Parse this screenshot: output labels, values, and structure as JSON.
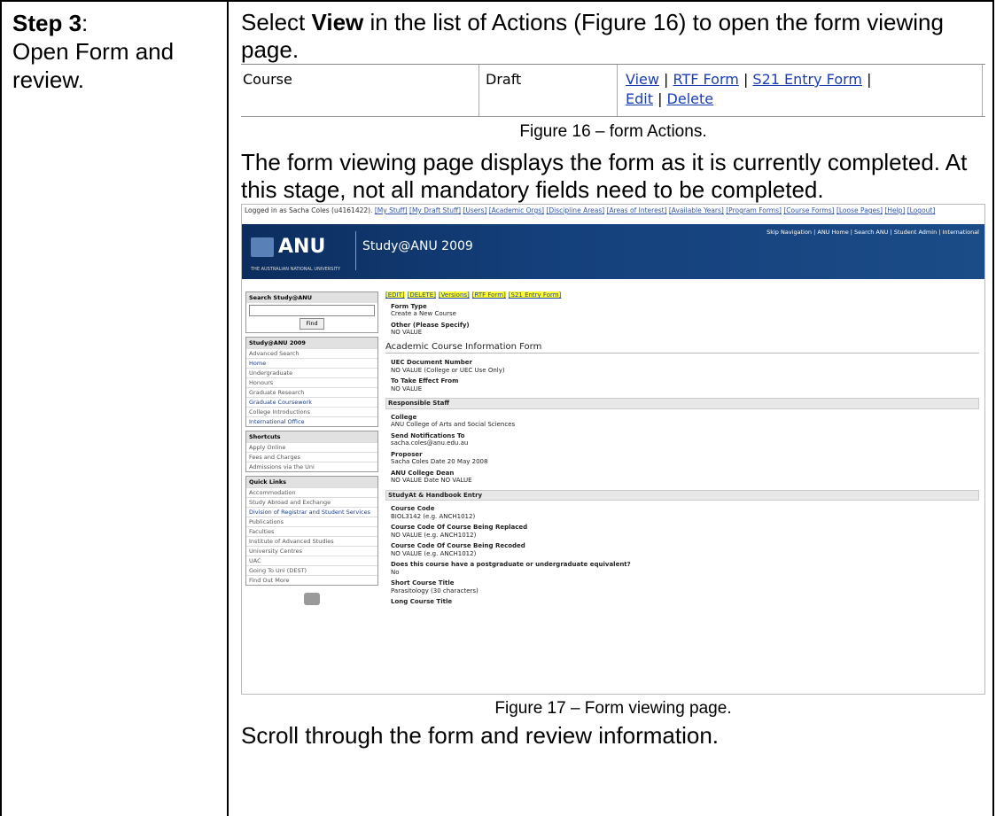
{
  "step": {
    "label": "Step 3",
    "colon": ":",
    "description": "Open Form and review."
  },
  "intro": {
    "before": "Select ",
    "bold": "View",
    "after": " in the list of Actions (Figure 16) to open the form viewing page."
  },
  "figure16": {
    "col1": "Course",
    "col2": "Draft",
    "links": [
      "View",
      "RTF Form",
      "S21 Entry Form",
      "Edit",
      "Delete"
    ],
    "sep": " | ",
    "caption": "Figure 16 – form Actions."
  },
  "para2": "The form viewing page displays the form as it is currently completed.  At this stage, not all mandatory fields need to be completed.",
  "figure17": {
    "caption": "Figure 17 – Form viewing page.",
    "logged_in": "Logged in as Sacha Coles (u4161422).",
    "top_links": [
      "[My Stuff]",
      "[My Draft Stuff]",
      "[Users]",
      "[Academic Orgs]",
      "[Discipline Areas]",
      "[Areas of Interest]",
      "[Available Years]",
      "[Program Forms]",
      "[Course Forms]",
      "[Loose Pages]",
      "[Help]",
      "[Logout]"
    ],
    "banner_nav": "Skip Navigation | ANU Home | Search ANU | Student Admin | International",
    "logo": "ANU",
    "university": "THE AUSTRALIAN NATIONAL UNIVERSITY",
    "site_title": "Study@ANU 2009",
    "search_header": "Search Study@ANU",
    "find_label": "Find",
    "study_header": "Study@ANU 2009",
    "study_items": [
      "Advanced Search",
      "Home",
      "Undergraduate",
      "Honours",
      "Graduate Research",
      "Graduate Coursework",
      "College Introductions",
      "International Office"
    ],
    "shortcuts_header": "Shortcuts",
    "shortcuts": [
      "Apply Online",
      "Fees and Charges",
      "Admissions via the Uni"
    ],
    "quick_header": "Quick Links",
    "quick_links": [
      "Accommodation",
      "Study Abroad and Exchange",
      "Division of Registrar and Student Services",
      "Publications",
      "Faculties",
      "Institute of Advanced Studies",
      "University Centres",
      "UAC",
      "Going To Uni (DEST)",
      "Find Out More"
    ],
    "actions": [
      "[EDIT]",
      "[DELETE]",
      "[Versions]",
      "[RTF Form]",
      "[S21 Entry Form]"
    ],
    "fields_a": [
      {
        "name": "Form Type",
        "value": "Create a New Course"
      },
      {
        "name": "Other (Please Specify)",
        "value": "NO VALUE"
      }
    ],
    "form_heading": "Academic Course Information Form",
    "fields_b": [
      {
        "name": "UEC Document Number",
        "value": "NO VALUE (College or UEC Use Only)"
      },
      {
        "name": "To Take Effect From",
        "value": "NO VALUE"
      }
    ],
    "section_staff": "Responsible Staff",
    "fields_c": [
      {
        "name": "College",
        "value": "ANU College of Arts and Social Sciences"
      },
      {
        "name": "Send Notifications To",
        "value": "sacha.coles@anu.edu.au"
      },
      {
        "name": "Proposer",
        "value": "Sacha Coles Date 20 May 2008"
      },
      {
        "name": "ANU College Dean",
        "value": "NO VALUE Date NO VALUE"
      }
    ],
    "section_handbook": "StudyAt & Handbook Entry",
    "fields_d": [
      {
        "name": "Course Code",
        "value": "BIOL3142 (e.g. ANCH1012)"
      },
      {
        "name": "Course Code Of Course Being Replaced",
        "value": "NO VALUE (e.g. ANCH1012)"
      },
      {
        "name": "Course Code Of Course Being Recoded",
        "value": "NO VALUE (e.g. ANCH1012)"
      },
      {
        "name": "Does this course have a postgraduate or undergraduate equivalent?",
        "value": "No"
      },
      {
        "name": "Short Course Title",
        "value": "Parasitology (30 characters)"
      },
      {
        "name": "Long Course Title",
        "value": ""
      }
    ]
  },
  "para3": "Scroll through the form and review information."
}
